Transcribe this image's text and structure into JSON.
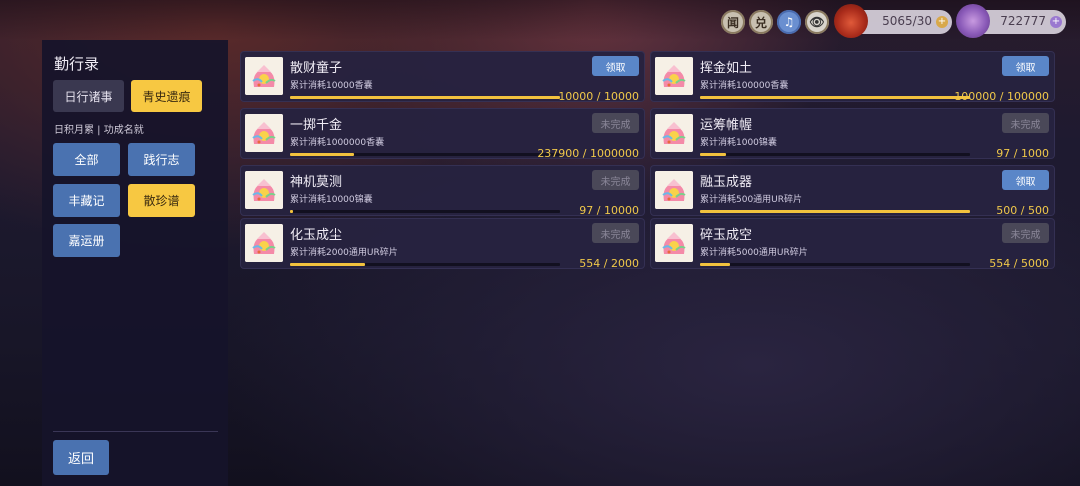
{
  "topbar": {
    "icons": [
      {
        "name": "news-icon",
        "glyph": "闻"
      },
      {
        "name": "exchange-icon",
        "glyph": "兑"
      },
      {
        "name": "music-icon",
        "glyph": "♫"
      },
      {
        "name": "eye-icon",
        "glyph": "👁"
      }
    ],
    "currency_sachet": "5065/30",
    "currency_brocade": "722777",
    "plus_glyph": "+"
  },
  "sidebar": {
    "title": "勤行录",
    "tabs": [
      "日行诸事",
      "青史遗痕"
    ],
    "subheading": "日积月累 | 功成名就",
    "categories": [
      "全部",
      "践行志",
      "丰藏记",
      "散珍谱",
      "嘉运册"
    ],
    "back_label": "返回"
  },
  "colors": {
    "accent": "#f7c842",
    "button_blue": "#4a72b0",
    "progress": "#f2c23e"
  },
  "cards": [
    {
      "title": "散财童子",
      "desc": "累计消耗10000香囊",
      "status": "领取",
      "progress_text": "10000 / 10000",
      "progress": 1.0
    },
    {
      "title": "挥金如土",
      "desc": "累计消耗100000香囊",
      "status": "领取",
      "progress_text": "100000 / 100000",
      "progress": 1.0
    },
    {
      "title": "一掷千金",
      "desc": "累计消耗1000000香囊",
      "status": "未完成",
      "progress_text": "237900 / 1000000",
      "progress": 0.2379
    },
    {
      "title": "运筹帷幄",
      "desc": "累计消耗1000锦囊",
      "status": "未完成",
      "progress_text": "97 / 1000",
      "progress": 0.097
    },
    {
      "title": "神机莫测",
      "desc": "累计消耗10000锦囊",
      "status": "未完成",
      "progress_text": "97 / 10000",
      "progress": 0.0097
    },
    {
      "title": "融玉成器",
      "desc": "累计消耗500通用UR碎片",
      "status": "领取",
      "progress_text": "500 / 500",
      "progress": 1.0
    },
    {
      "title": "化玉成尘",
      "desc": "累计消耗2000通用UR碎片",
      "status": "未完成",
      "progress_text": "554 / 2000",
      "progress": 0.277
    },
    {
      "title": "碎玉成空",
      "desc": "累计消耗5000通用UR碎片",
      "status": "未完成",
      "progress_text": "554 / 5000",
      "progress": 0.1108
    }
  ]
}
